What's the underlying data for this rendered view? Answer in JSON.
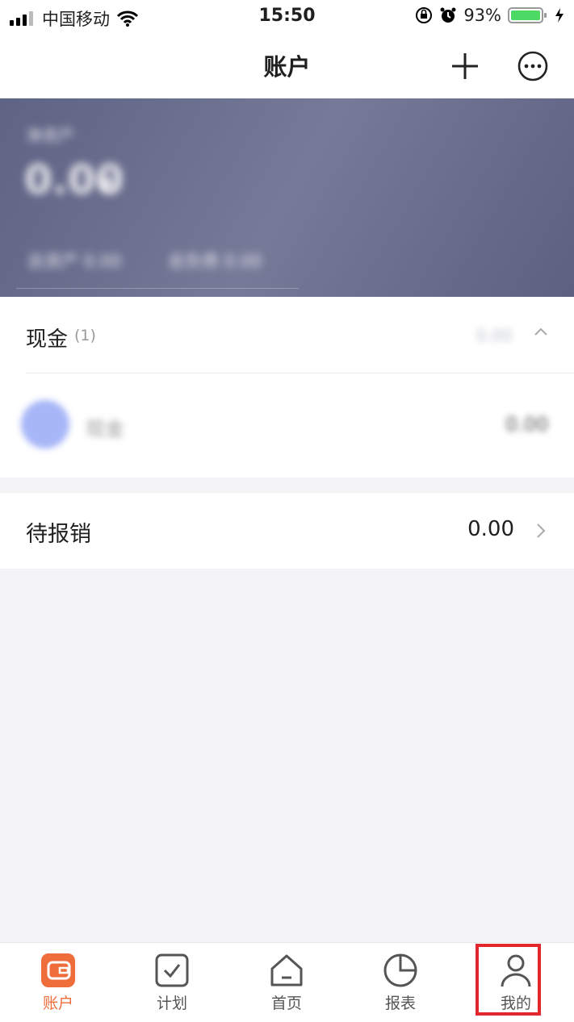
{
  "status_bar": {
    "carrier": "中国移动",
    "time": "15:50",
    "battery": "93%"
  },
  "nav": {
    "title": "账户",
    "add_icon": "plus-icon",
    "more_icon": "more-icon"
  },
  "banner": {
    "asset_label": "净资产",
    "asset_amount": "0.00",
    "stat_1": "总资产 0.00",
    "stat_2": "总负债 0.00"
  },
  "account_group": {
    "title": "现金",
    "count": "(1)",
    "total": "0.00",
    "accounts": [
      {
        "name": "现金",
        "amount": "0.00"
      }
    ]
  },
  "pending": {
    "label": "待报销",
    "amount": "0.00"
  },
  "tabs": [
    {
      "label": "账户",
      "icon": "wallet-icon",
      "active": true
    },
    {
      "label": "计划",
      "icon": "checkbox-icon",
      "active": false
    },
    {
      "label": "首页",
      "icon": "home-icon",
      "active": false
    },
    {
      "label": "报表",
      "icon": "pie-chart-icon",
      "active": false
    },
    {
      "label": "我的",
      "icon": "user-icon",
      "active": false
    }
  ],
  "colors": {
    "accent": "#ee6d3b",
    "banner": "#676b8c",
    "highlight": "#e3262c"
  }
}
